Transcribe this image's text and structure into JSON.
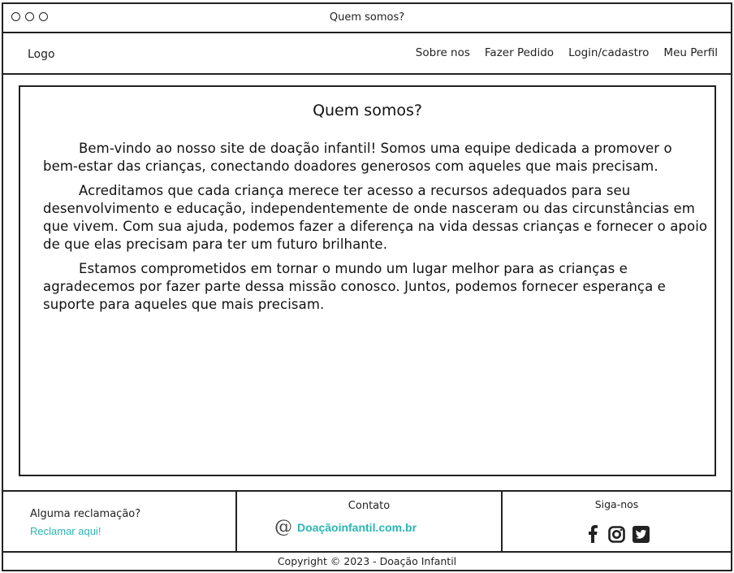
{
  "window": {
    "title": "Quem somos?"
  },
  "nav": {
    "logo": "Logo",
    "links": [
      "Sobre nos",
      "Fazer Pedido",
      "Login/cadastro",
      "Meu Perfil"
    ]
  },
  "content": {
    "title": "Quem somos?",
    "paragraphs": [
      "Bem-vindo ao nosso site de doação infantil! Somos uma equipe dedicada a promover o bem-estar das crianças, conectando doadores generosos com aqueles que mais precisam.",
      "Acreditamos que cada criança merece ter acesso a recursos adequados para seu desenvolvimento e educação, independentemente de onde nasceram ou das circunstâncias em que vivem. Com sua ajuda, podemos fazer a diferença na vida dessas crianças e fornecer o apoio de que elas precisam para ter um futuro brilhante.",
      "Estamos comprometidos em tornar o mundo um lugar melhor para as crianças e agradecemos por fazer parte dessa missão conosco. Juntos, podemos fornecer esperança e suporte para aqueles que mais precisam."
    ]
  },
  "footer": {
    "complaint_label": "Alguma reclamação?",
    "complaint_link": "Reclamar aqui!",
    "contact_label": "Contato",
    "contact_email": "Doaçãoinfantil.com.br",
    "follow_label": "Siga-nos",
    "social_icons": [
      "facebook-icon",
      "instagram-icon",
      "twitter-icon"
    ],
    "copyright": "Copyright © 2023 - Doação Infantil"
  },
  "colors": {
    "accent": "#2bb5b5",
    "border": "#222222"
  }
}
